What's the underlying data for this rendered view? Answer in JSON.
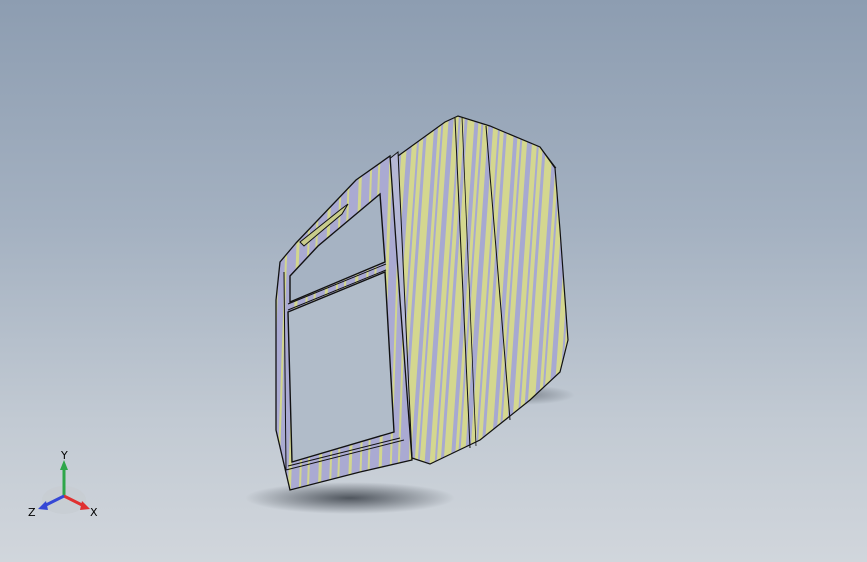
{
  "viewport": {
    "background_top": "#8d9db1",
    "background_bottom": "#d1d6dc",
    "model": {
      "part": "door-panel",
      "surface_colors": [
        "#d6d98d",
        "#a8a8cf"
      ],
      "edge_color": "#000000"
    }
  },
  "triad": {
    "x_label": "X",
    "y_label": "Y",
    "z_label": "Z",
    "x_color": "#e03030",
    "y_color": "#2ea64a",
    "z_color": "#3548d6"
  }
}
